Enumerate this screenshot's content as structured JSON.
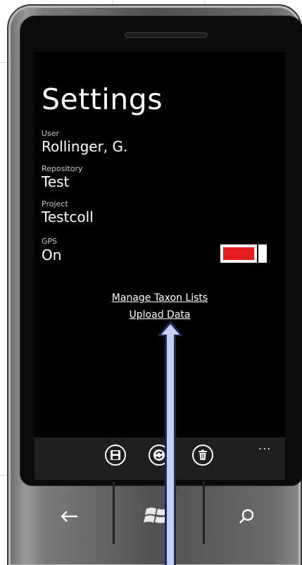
{
  "screen": {
    "title": "Settings",
    "fields": [
      {
        "label": "User",
        "value": "Rollinger, G."
      },
      {
        "label": "Repository",
        "value": "Test"
      },
      {
        "label": "Project",
        "value": "Testcoll"
      },
      {
        "label": "GPS",
        "value": "On"
      }
    ],
    "gps_toggle": {
      "state": "on",
      "accent": "#e31c1c"
    },
    "links": {
      "manage_taxon": "Manage Taxon Lists",
      "upload": "Upload Data"
    }
  },
  "appbar": {
    "buttons": [
      {
        "icon": "save-icon"
      },
      {
        "icon": "sync-icon"
      },
      {
        "icon": "delete-icon"
      }
    ],
    "more": "..."
  },
  "hardware_nav": {
    "buttons": [
      {
        "icon": "back-arrow-icon"
      },
      {
        "icon": "windows-start-icon"
      },
      {
        "icon": "search-icon"
      }
    ]
  },
  "colors": {
    "background": "#000000",
    "foreground": "#ffffff",
    "appbar": "#1f1f1f",
    "annotation_arrow": "#c7cff2"
  }
}
